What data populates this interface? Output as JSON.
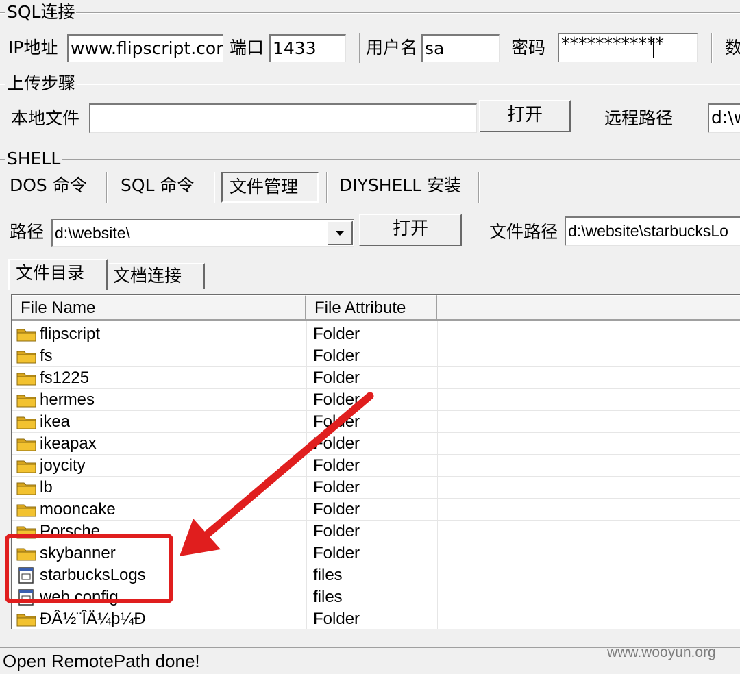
{
  "sql_group": {
    "title": "SQL连接",
    "ip_label": "IP地址",
    "ip_value": "www.flipscript.con",
    "port_label": "端口",
    "port_value": "1433",
    "user_label": "用户名",
    "user_value": "sa",
    "pass_label": "密码",
    "pass_value": "************",
    "cut_label": "数"
  },
  "upload_group": {
    "title": "上传步骤",
    "local_label": "本地文件",
    "local_value": "",
    "open_button": "打开",
    "remote_label": "远程路径",
    "remote_value": "d:\\w"
  },
  "shell_group": {
    "title": "SHELL",
    "tabs": [
      "DOS 命令",
      "SQL 命令",
      "文件管理",
      "DIYSHELL 安装"
    ],
    "path_label": "路径",
    "path_value": "d:\\website\\",
    "open_button": "打开",
    "file_path_label": "文件路径",
    "file_path_value": "d:\\website\\starbucksLo"
  },
  "subtabs": [
    "文件目录",
    "文档连接"
  ],
  "list": {
    "headers": [
      "File Name",
      "File Attribute"
    ],
    "rows": [
      {
        "name": "flipscript",
        "attr": "Folder",
        "icon": "folder-icon"
      },
      {
        "name": "fs",
        "attr": "Folder",
        "icon": "folder-icon"
      },
      {
        "name": "fs1225",
        "attr": "Folder",
        "icon": "folder-icon"
      },
      {
        "name": "hermes",
        "attr": "Folder",
        "icon": "folder-icon"
      },
      {
        "name": "ikea",
        "attr": "Folder",
        "icon": "folder-icon"
      },
      {
        "name": "ikeapax",
        "attr": "Folder",
        "icon": "folder-icon"
      },
      {
        "name": "joycity",
        "attr": "Folder",
        "icon": "folder-icon"
      },
      {
        "name": "lb",
        "attr": "Folder",
        "icon": "folder-icon"
      },
      {
        "name": "mooncake",
        "attr": "Folder",
        "icon": "folder-icon"
      },
      {
        "name": "Porsche",
        "attr": "Folder",
        "icon": "folder-icon"
      },
      {
        "name": "skybanner",
        "attr": "Folder",
        "icon": "folder-icon"
      },
      {
        "name": "starbucksLogs",
        "attr": "files",
        "icon": "file-icon"
      },
      {
        "name": "web.config",
        "attr": "files",
        "icon": "file-icon"
      },
      {
        "name": "ÐÂ½¨ÎÄ¼þ¼Ð",
        "attr": "Folder",
        "icon": "folder-icon"
      }
    ]
  },
  "status_text": "Open RemotePath done!",
  "watermark": "www.wooyun.org",
  "colors": {
    "annotation_red": "#e01e1e",
    "folder_yellow": "#f2c230"
  }
}
